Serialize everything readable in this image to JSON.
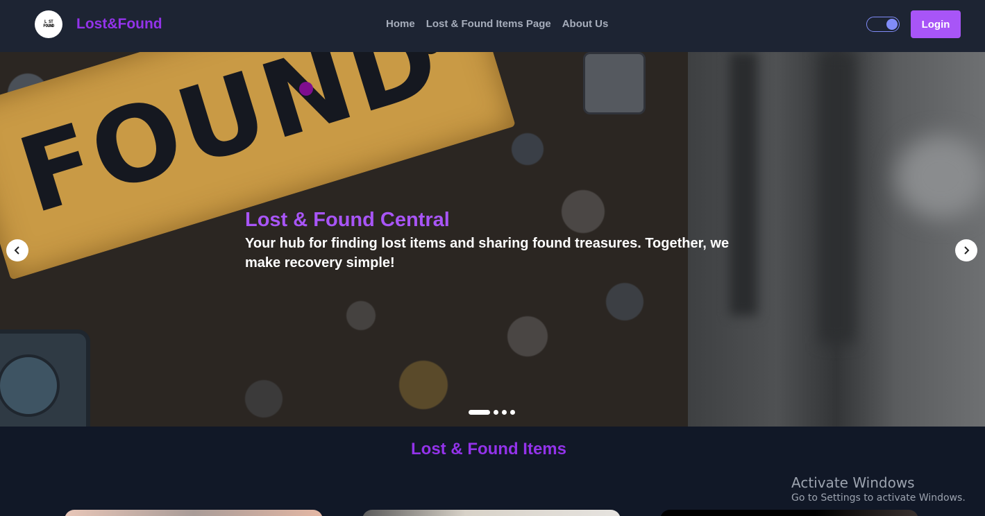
{
  "navbar": {
    "logo_text": "L ST\nFOUND",
    "brand": "Lost&Found",
    "links": [
      {
        "label": "Home"
      },
      {
        "label": "Lost & Found Items Page"
      },
      {
        "label": "About Us"
      }
    ],
    "theme_toggle_icon": "toggle-icon",
    "login_label": "Login"
  },
  "hero": {
    "image_sign_text": "FOUND",
    "title": "Lost & Found Central",
    "subtitle": "Your hub for finding lost items and sharing found treasures. Together, we make recovery simple!",
    "prev_icon": "chevron-left-icon",
    "next_icon": "chevron-right-icon",
    "slide_count": 4,
    "active_slide": 1
  },
  "section": {
    "title": "Lost & Found Items"
  },
  "windows_watermark": {
    "title": "Activate Windows",
    "subtitle": "Go to Settings to activate Windows."
  },
  "colors": {
    "brand": "#9333ea",
    "accent": "#a855f7",
    "navbar_bg": "#1d2433",
    "page_bg": "#111827",
    "toggle": "#818cf8"
  }
}
